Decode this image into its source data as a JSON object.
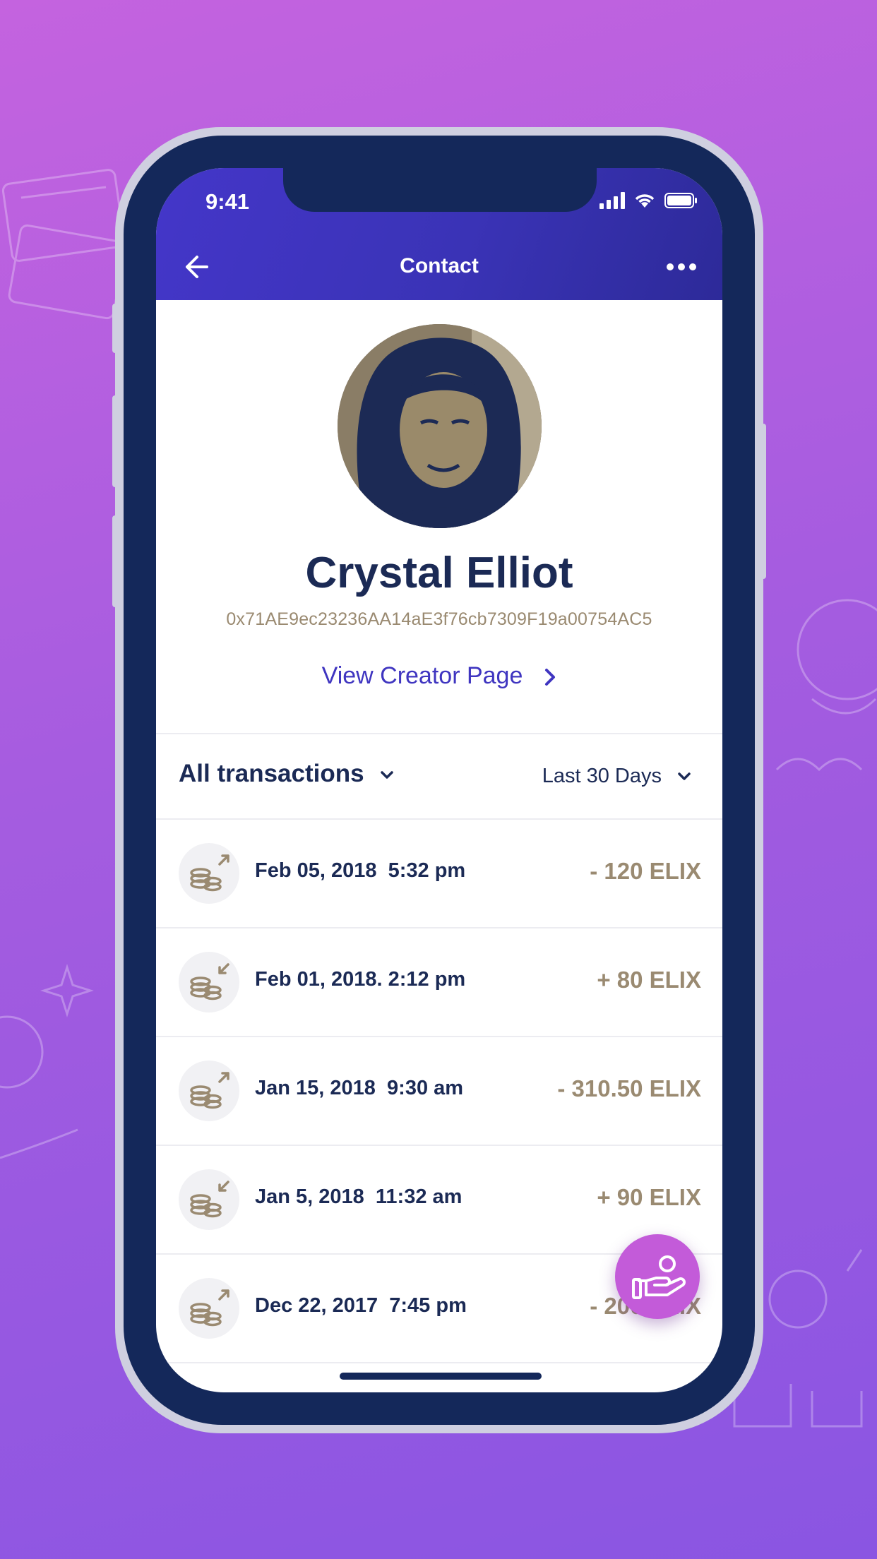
{
  "status_bar": {
    "time": "9:41"
  },
  "header": {
    "title": "Contact"
  },
  "profile": {
    "name": "Crystal Elliot",
    "address": "0x71AE9ec23236AA14aE3f76cb7309F19a00754AC5",
    "creator_link": "View Creator Page"
  },
  "filters": {
    "type": "All transactions",
    "period": "Last 30 Days"
  },
  "transactions": [
    {
      "date": "Feb 05, 2018  5:32 pm",
      "amount": "- 120 ELIX",
      "direction": "outgoing"
    },
    {
      "date": "Feb 01, 2018. 2:12 pm",
      "amount": "+ 80 ELIX",
      "direction": "incoming"
    },
    {
      "date": "Jan 15, 2018  9:30 am",
      "amount": "- 310.50 ELIX",
      "direction": "outgoing"
    },
    {
      "date": "Jan 5, 2018  11:32 am",
      "amount": "+ 90 ELIX",
      "direction": "incoming"
    },
    {
      "date": "Dec 22, 2017  7:45 pm",
      "amount": "- 200 ELIX",
      "direction": "outgoing"
    }
  ],
  "colors": {
    "header_start": "#4436c9",
    "header_end": "#2d2a99",
    "navy": "#1b2a55",
    "gold": "#9a8a71",
    "link": "#3f35c0",
    "fab": "#c35bd9"
  },
  "icons": {
    "back": "arrow-left-icon",
    "more": "more-dots-icon",
    "creator_chevron": "chevron-right-icon",
    "filter_caret": "chevron-down-icon",
    "transaction": "coins-icon",
    "fab": "hand-coin-icon"
  }
}
